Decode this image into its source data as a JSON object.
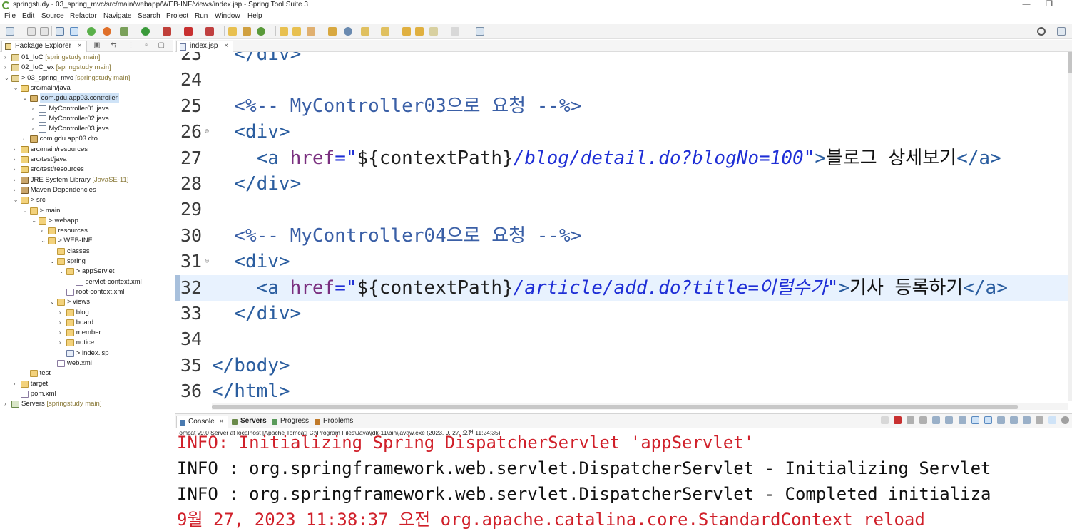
{
  "window": {
    "title": "springstudy - 03_spring_mvc/src/main/webapp/WEB-INF/views/index.jsp - Spring Tool Suite 3",
    "minimize": "—",
    "restore": "❐"
  },
  "menu": [
    "File",
    "Edit",
    "Source",
    "Refactor",
    "Navigate",
    "Search",
    "Project",
    "Run",
    "Window",
    "Help"
  ],
  "explorer": {
    "tab_label": "Package Explorer",
    "close": "×",
    "tools": "▣ ⇆ ⋮ ▫ ▢",
    "items": [
      {
        "tw": "›",
        "label": "01_IoC",
        "dec": " [springstudy main]",
        "icon": "proj"
      },
      {
        "tw": "›",
        "label": "02_IoC_ex",
        "dec": " [springstudy main]",
        "icon": "proj"
      },
      {
        "tw": "⌄",
        "label": "> 03_spring_mvc",
        "dec": " [springstudy main]",
        "icon": "proj"
      },
      {
        "tw": "⌄",
        "label": "src/main/java",
        "dec": "",
        "icon": "srcf"
      },
      {
        "tw": "⌄",
        "label": "com.gdu.app03.controller",
        "dec": "",
        "icon": "pkg"
      },
      {
        "tw": "›",
        "label": "MyController01.java",
        "dec": "",
        "icon": "java"
      },
      {
        "tw": "›",
        "label": "MyController02.java",
        "dec": "",
        "icon": "java"
      },
      {
        "tw": "›",
        "label": "MyController03.java",
        "dec": "",
        "icon": "java"
      },
      {
        "tw": "›",
        "label": "com.gdu.app03.dto",
        "dec": "",
        "icon": "pkg"
      },
      {
        "tw": "›",
        "label": "src/main/resources",
        "dec": "",
        "icon": "srcf"
      },
      {
        "tw": "›",
        "label": "src/test/java",
        "dec": "",
        "icon": "srcf"
      },
      {
        "tw": "›",
        "label": "src/test/resources",
        "dec": "",
        "icon": "srcf"
      },
      {
        "tw": "›",
        "label": "JRE System Library",
        "dec": " [JavaSE-11]",
        "icon": "lib"
      },
      {
        "tw": "›",
        "label": "Maven Dependencies",
        "dec": "",
        "icon": "lib"
      },
      {
        "tw": "⌄",
        "label": "> src",
        "dec": "",
        "icon": "folder"
      },
      {
        "tw": "⌄",
        "label": "> main",
        "dec": "",
        "icon": "folder"
      },
      {
        "tw": "⌄",
        "label": "> webapp",
        "dec": "",
        "icon": "folder"
      },
      {
        "tw": "›",
        "label": "resources",
        "dec": "",
        "icon": "folder"
      },
      {
        "tw": "⌄",
        "label": "> WEB-INF",
        "dec": "",
        "icon": "folder"
      },
      {
        "tw": "",
        "label": "classes",
        "dec": "",
        "icon": "folder"
      },
      {
        "tw": "⌄",
        "label": "spring",
        "dec": "",
        "icon": "folder"
      },
      {
        "tw": "⌄",
        "label": "> appServlet",
        "dec": "",
        "icon": "folder"
      },
      {
        "tw": "",
        "label": "servlet-context.xml",
        "dec": "",
        "icon": "xml"
      },
      {
        "tw": "",
        "label": "root-context.xml",
        "dec": "",
        "icon": "xml"
      },
      {
        "tw": "⌄",
        "label": "> views",
        "dec": "",
        "icon": "folder"
      },
      {
        "tw": "›",
        "label": "blog",
        "dec": "",
        "icon": "folder"
      },
      {
        "tw": "›",
        "label": "board",
        "dec": "",
        "icon": "folder"
      },
      {
        "tw": "›",
        "label": "member",
        "dec": "",
        "icon": "folder"
      },
      {
        "tw": "›",
        "label": "notice",
        "dec": "",
        "icon": "folder"
      },
      {
        "tw": "",
        "label": "> index.jsp",
        "dec": "",
        "icon": "jsp"
      },
      {
        "tw": "",
        "label": "web.xml",
        "dec": "",
        "icon": "xml"
      },
      {
        "tw": "",
        "label": "test",
        "dec": "",
        "icon": "folder"
      },
      {
        "tw": "›",
        "label": "target",
        "dec": "",
        "icon": "folder"
      },
      {
        "tw": "",
        "label": "pom.xml",
        "dec": "",
        "icon": "xml"
      },
      {
        "tw": "›",
        "label": "Servers",
        "dec": " [springstudy main]",
        "icon": "server"
      }
    ]
  },
  "editor": {
    "tab_label": "index.jsp",
    "close": "×",
    "lines": [
      {
        "n": "23",
        "segs": [
          {
            "t": "  </div>",
            "c": "t-tag"
          }
        ]
      },
      {
        "n": "24",
        "segs": []
      },
      {
        "n": "25",
        "segs": [
          {
            "t": "  <%-- MyController03으로 요청 --%>",
            "c": "t-cmt"
          }
        ]
      },
      {
        "n": "26",
        "fold": "⊖",
        "segs": [
          {
            "t": "  <div>",
            "c": "t-tag"
          }
        ]
      },
      {
        "n": "27",
        "segs": [
          {
            "t": "    <a ",
            "c": "t-tag"
          },
          {
            "t": "href",
            "c": "t-attr"
          },
          {
            "t": "=\"",
            "c": "t-str"
          },
          {
            "t": "${contextPath}",
            "c": "t-el"
          },
          {
            "t": "/blog/detail.do?blogNo=100\"",
            "c": "t-str"
          },
          {
            "t": ">",
            "c": "t-tag"
          },
          {
            "t": "블로그 상세보기",
            "c": "t-txt"
          },
          {
            "t": "</a>",
            "c": "t-tag"
          }
        ]
      },
      {
        "n": "28",
        "segs": [
          {
            "t": "  </div>",
            "c": "t-tag"
          }
        ]
      },
      {
        "n": "29",
        "segs": []
      },
      {
        "n": "30",
        "segs": [
          {
            "t": "  <%-- MyController04으로 요청 --%>",
            "c": "t-cmt"
          }
        ]
      },
      {
        "n": "31",
        "fold": "⊖",
        "segs": [
          {
            "t": "  <div>",
            "c": "t-tag"
          }
        ]
      },
      {
        "n": "32",
        "cur": true,
        "segs": [
          {
            "t": "    <a ",
            "c": "t-tag"
          },
          {
            "t": "href",
            "c": "t-attr"
          },
          {
            "t": "=\"",
            "c": "t-str"
          },
          {
            "t": "${contextPath}",
            "c": "t-el"
          },
          {
            "t": "/article/add.do?title=이럴수가\"",
            "c": "t-str"
          },
          {
            "t": ">",
            "c": "t-tag"
          },
          {
            "t": "기사 등록하기",
            "c": "t-txt"
          },
          {
            "t": "</a>",
            "c": "t-tag"
          }
        ]
      },
      {
        "n": "33",
        "segs": [
          {
            "t": "  </div>",
            "c": "t-tag"
          }
        ]
      },
      {
        "n": "34",
        "segs": []
      },
      {
        "n": "35",
        "segs": [
          {
            "t": "</body>",
            "c": "t-tag"
          }
        ]
      },
      {
        "n": "36",
        "segs": [
          {
            "t": "</html>",
            "c": "t-tag"
          }
        ]
      }
    ]
  },
  "console": {
    "tabs": [
      {
        "label": "Console",
        "close": "×",
        "active": true,
        "color": "#4a7ab0"
      },
      {
        "label": "Servers",
        "active": false,
        "bold": true,
        "color": "#6a8a4a"
      },
      {
        "label": "Progress",
        "active": false,
        "color": "#5a9a5a"
      },
      {
        "label": "Problems",
        "active": false,
        "color": "#c07a2a"
      }
    ],
    "status": "Tomcat v9.0 Server at localhost [Apache Tomcat] C:\\Program Files\\Java\\jdk-11\\bin\\javaw.exe  (2023. 9. 27. 오전 11:24:35)",
    "lines": [
      {
        "text": "INFO: Initializing Spring DispatcherServlet 'appServlet'",
        "color": "red"
      },
      {
        "text": "INFO : org.springframework.web.servlet.DispatcherServlet - Initializing Servlet",
        "color": "black"
      },
      {
        "text": "INFO : org.springframework.web.servlet.DispatcherServlet - Completed initializa",
        "color": "black"
      },
      {
        "text": "9월 27, 2023 11:38:37 오전 org.apache.catalina.core.StandardContext reload",
        "color": "red"
      }
    ]
  },
  "colors": {
    "accent": "#cfe3f7",
    "current_line": "#e8f2fe",
    "console_error": "#d0202a"
  }
}
